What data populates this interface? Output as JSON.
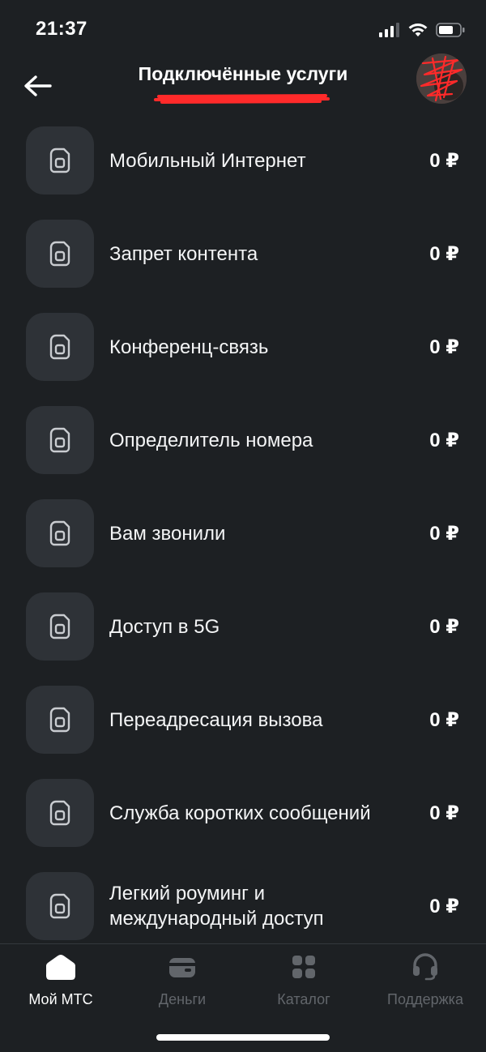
{
  "status_bar": {
    "time": "21:37",
    "icons": [
      "cellular-signal-icon",
      "wifi-icon",
      "battery-icon"
    ]
  },
  "header": {
    "title": "Подключённые услуги",
    "back_icon": "arrow-left-icon",
    "redaction_color": "#ff2a2a"
  },
  "services": [
    {
      "name": "Мобильный Интернет",
      "price": "0 ₽",
      "icon": "sim-card-icon"
    },
    {
      "name": "Запрет контента",
      "price": "0 ₽",
      "icon": "sim-card-icon"
    },
    {
      "name": "Конференц-связь",
      "price": "0 ₽",
      "icon": "sim-card-icon"
    },
    {
      "name": "Определитель номера",
      "price": "0 ₽",
      "icon": "sim-card-icon"
    },
    {
      "name": "Вам звонили",
      "price": "0 ₽",
      "icon": "sim-card-icon"
    },
    {
      "name": "Доступ в 5G",
      "price": "0 ₽",
      "icon": "sim-card-icon"
    },
    {
      "name": "Переадресация вызова",
      "price": "0 ₽",
      "icon": "sim-card-icon"
    },
    {
      "name": "Служба коротких сообщений",
      "price": "0 ₽",
      "icon": "sim-card-icon"
    },
    {
      "name": "Легкий роуминг и международный доступ",
      "price": "0 ₽",
      "icon": "sim-card-icon"
    }
  ],
  "tab_bar": {
    "tabs": [
      {
        "label": "Мой МТС",
        "icon": "home-icon",
        "active": true
      },
      {
        "label": "Деньги",
        "icon": "wallet-icon",
        "active": false
      },
      {
        "label": "Каталог",
        "icon": "grid-icon",
        "active": false
      },
      {
        "label": "Поддержка",
        "icon": "headset-icon",
        "active": false
      }
    ]
  },
  "colors": {
    "background": "#1d2023",
    "icon_tile": "#2e3237",
    "inactive_tab": "#62666b",
    "active_tab": "#ffffff"
  }
}
